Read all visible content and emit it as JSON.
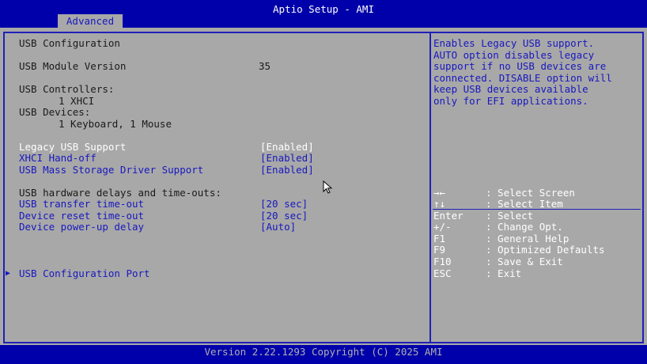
{
  "app_title": "Aptio Setup - AMI",
  "tabs": [
    "Advanced"
  ],
  "left": {
    "section_title": "USB Configuration",
    "module_version_label": "USB Module Version",
    "module_version_value": "35",
    "controllers_label": "USB Controllers:",
    "controllers_value": "1 XHCI",
    "devices_label": "USB Devices:",
    "devices_value": "1 Keyboard, 1 Mouse",
    "settings": [
      {
        "label": "Legacy USB Support",
        "value": "[Enabled]"
      },
      {
        "label": "XHCI Hand-off",
        "value": "[Enabled]"
      },
      {
        "label": "USB Mass Storage Driver Support",
        "value": "[Enabled]"
      }
    ],
    "delays_header": "USB hardware delays and time-outs:",
    "delays": [
      {
        "label": "USB transfer time-out",
        "value": "[20 sec]"
      },
      {
        "label": "Device reset time-out",
        "value": "[20 sec]"
      },
      {
        "label": "Device power-up delay",
        "value": "[Auto]"
      }
    ],
    "submenu_arrow": "▶",
    "submenu_label": "USB Configuration Port"
  },
  "help": {
    "lines": [
      "Enables Legacy USB support.",
      "AUTO option disables legacy",
      "support if no USB devices are",
      "connected. DISABLE option will",
      "keep USB devices available",
      "only for EFI applications."
    ]
  },
  "keys": [
    {
      "key": "→←",
      "desc": ": Select Screen"
    },
    {
      "key": "↑↓",
      "desc": ": Select Item"
    },
    {
      "key": "Enter",
      "desc": ": Select"
    },
    {
      "key": "+/-",
      "desc": ": Change Opt."
    },
    {
      "key": "F1",
      "desc": ": General Help"
    },
    {
      "key": "F9",
      "desc": ": Optimized Defaults"
    },
    {
      "key": "F10",
      "desc": ": Save & Exit"
    },
    {
      "key": "ESC",
      "desc": ": Exit"
    }
  ],
  "footer": "Version 2.22.1293 Copyright (C) 2025 AMI",
  "colors": {
    "background": "#0000aa",
    "panel": "#a8a8a8",
    "selected_text": "#ffffff",
    "option_text": "#1818c0"
  }
}
